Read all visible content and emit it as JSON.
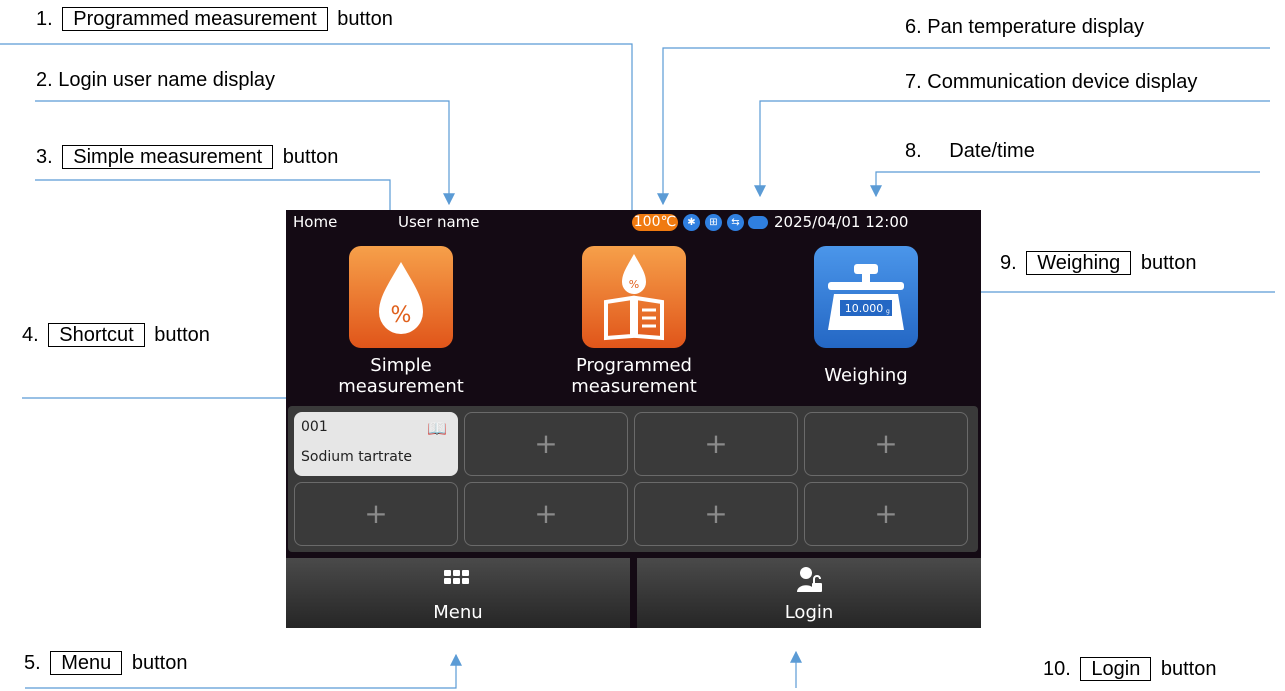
{
  "callouts": {
    "c1": {
      "num": "1.",
      "boxed": "Programmed measurement",
      "suffix": "button"
    },
    "c2": {
      "num": "2.",
      "text": "Login user name display"
    },
    "c3": {
      "num": "3.",
      "boxed": "Simple measurement",
      "suffix": "button"
    },
    "c4": {
      "num": "4.",
      "boxed": "Shortcut",
      "suffix": "button"
    },
    "c5": {
      "num": "5.",
      "boxed": "Menu",
      "suffix": "button"
    },
    "c6": {
      "num": "6.",
      "text": "Pan temperature display"
    },
    "c7": {
      "num": "7.",
      "text": "Communication device display"
    },
    "c8": {
      "num": "8.",
      "text": "Date/time"
    },
    "c9": {
      "num": "9.",
      "boxed": "Weighing",
      "suffix": "button"
    },
    "c10": {
      "num": "10.",
      "boxed": "Login",
      "suffix": "button"
    }
  },
  "screen": {
    "status": {
      "page": "Home",
      "user": "User name",
      "temperature": "100℃",
      "datetime": "2025/04/01 12:00",
      "icons": [
        "bluetooth-icon",
        "network-icon",
        "usb-device-icon",
        "usb-memory-icon"
      ]
    },
    "apps": {
      "simple": {
        "line1": "Simple",
        "line2": "measurement"
      },
      "programmed": {
        "line1": "Programmed",
        "line2": "measurement"
      },
      "weighing": {
        "label": "Weighing",
        "display_value": "10.000",
        "unit": "g"
      }
    },
    "shortcut": {
      "number": "001",
      "name": "Sodium tartrate"
    },
    "plus": "+",
    "menu_label": "Menu",
    "login_label": "Login"
  },
  "colors": {
    "accent_orange": "#f07a10",
    "accent_blue": "#2f7fe0",
    "leader_line": "#5b9bd5",
    "screen_bg": "#140a14"
  }
}
